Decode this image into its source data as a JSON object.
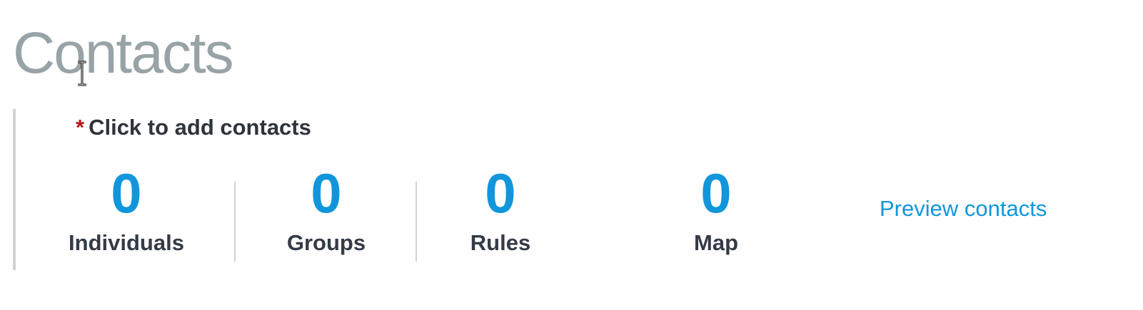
{
  "page": {
    "title": "Contacts"
  },
  "contacts": {
    "required_marker": "*",
    "instruction": "Click to add contacts",
    "stats": [
      {
        "count": "0",
        "label": "Individuals"
      },
      {
        "count": "0",
        "label": "Groups"
      },
      {
        "count": "0",
        "label": "Rules"
      },
      {
        "count": "0",
        "label": "Map"
      }
    ],
    "preview_link": "Preview contacts"
  },
  "colors": {
    "title": "#98a3a7",
    "accent": "#1296db",
    "required": "#b5131b",
    "label": "#343b46",
    "divider": "#d2d2d2"
  },
  "icons": {
    "cursor": "text-cursor-icon"
  }
}
